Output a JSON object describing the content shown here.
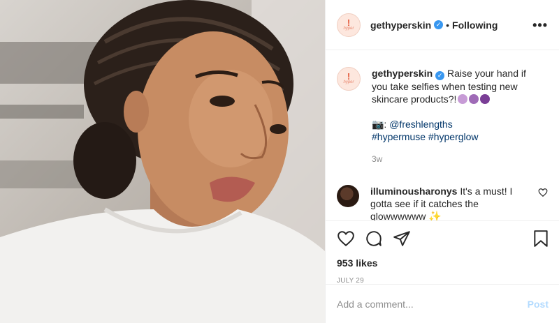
{
  "photo": {
    "alt": ""
  },
  "header": {
    "avatar_mark": "!",
    "avatar_word": "hyper",
    "username": "gethyperskin",
    "separator": "•",
    "follow_state": "Following",
    "more_glyph": "•••"
  },
  "caption": {
    "username": "gethyperskin",
    "text": "Raise your hand if you take selfies when testing new skincare products?!",
    "credit_prefix": "📷:",
    "credit_handle": "@freshlengths",
    "hashtags": "#hypermuse #hyperglow",
    "time": "3w"
  },
  "comment": {
    "username": "illuminousharonys",
    "text": "It's a must! I gotta see if it catches the glowwwwww",
    "sparkle": "✨"
  },
  "actions": {
    "likes": "953 likes",
    "date": "JULY 29"
  },
  "add_comment": {
    "placeholder": "Add a comment...",
    "post_label": "Post"
  },
  "colors": {
    "verified": "#3897f0",
    "link": "#003569",
    "post_disabled": "#b3dbff",
    "brand": "#e35a3c"
  },
  "icons": [
    "heart-icon",
    "comment-icon",
    "share-icon",
    "bookmark-icon",
    "more-icon",
    "verified-icon",
    "camera-icon",
    "sparkle-icon"
  ]
}
